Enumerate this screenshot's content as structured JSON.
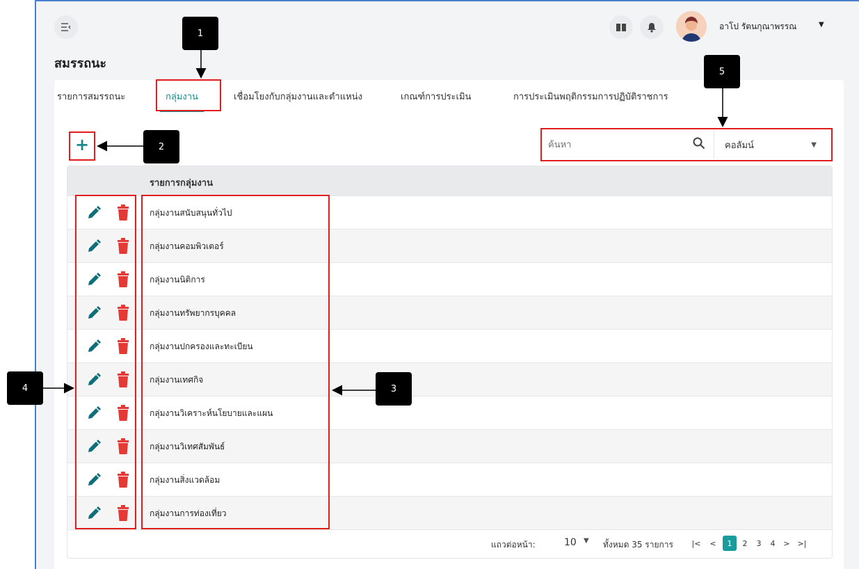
{
  "header": {
    "username": "อาโป รัตนกุณาพรรณ"
  },
  "page": {
    "title": "สมรรถนะ"
  },
  "tabs": [
    {
      "label": "รายการสมรรถนะ"
    },
    {
      "label": "กลุ่มงาน"
    },
    {
      "label": "เชื่อมโยงกับกลุ่มงานและตำแหน่ง"
    },
    {
      "label": "เกณฑ์การประเมิน"
    },
    {
      "label": "การประเมินพฤติกรรมการปฏิบัติราชการ"
    }
  ],
  "active_tab": "กลุ่มงาน",
  "toolbar": {
    "add_label": "+",
    "search_placeholder": "ค้นหา",
    "column_label": "คอลัมน์"
  },
  "table": {
    "header": "รายการกลุ่มงาน",
    "rows": [
      {
        "name": "กลุ่มงานสนับสนุนทั่วไป"
      },
      {
        "name": "กลุ่มงานคอมพิวเตอร์"
      },
      {
        "name": "กลุ่มงานนิติการ"
      },
      {
        "name": "กลุ่มงานทรัพยากรบุคคล"
      },
      {
        "name": "กลุ่มงานปกครองและทะเบียน"
      },
      {
        "name": "กลุ่มงานเทศกิจ"
      },
      {
        "name": "กลุ่มงานวิเคราะห์นโยบายและแผน"
      },
      {
        "name": "กลุ่มงานวิเทศสัมพันธ์"
      },
      {
        "name": "กลุ่มงานสิ่งแวดล้อม"
      },
      {
        "name": "กลุ่มงานการท่องเที่ยว"
      }
    ]
  },
  "pagination": {
    "rows_per_page_label": "แถวต่อหน้า:",
    "rows_per_page": "10",
    "total": "ทั้งหมด 35 รายการ",
    "first": "|<",
    "prev": "<",
    "pages": [
      "1",
      "2",
      "3",
      "4"
    ],
    "current_page": "1",
    "next": ">",
    "last": ">|"
  },
  "callouts": [
    "1",
    "2",
    "3",
    "4",
    "5"
  ],
  "colors": {
    "accent": "#1a8a8a",
    "delete": "#e53935",
    "highlight": "#e11d1d"
  }
}
